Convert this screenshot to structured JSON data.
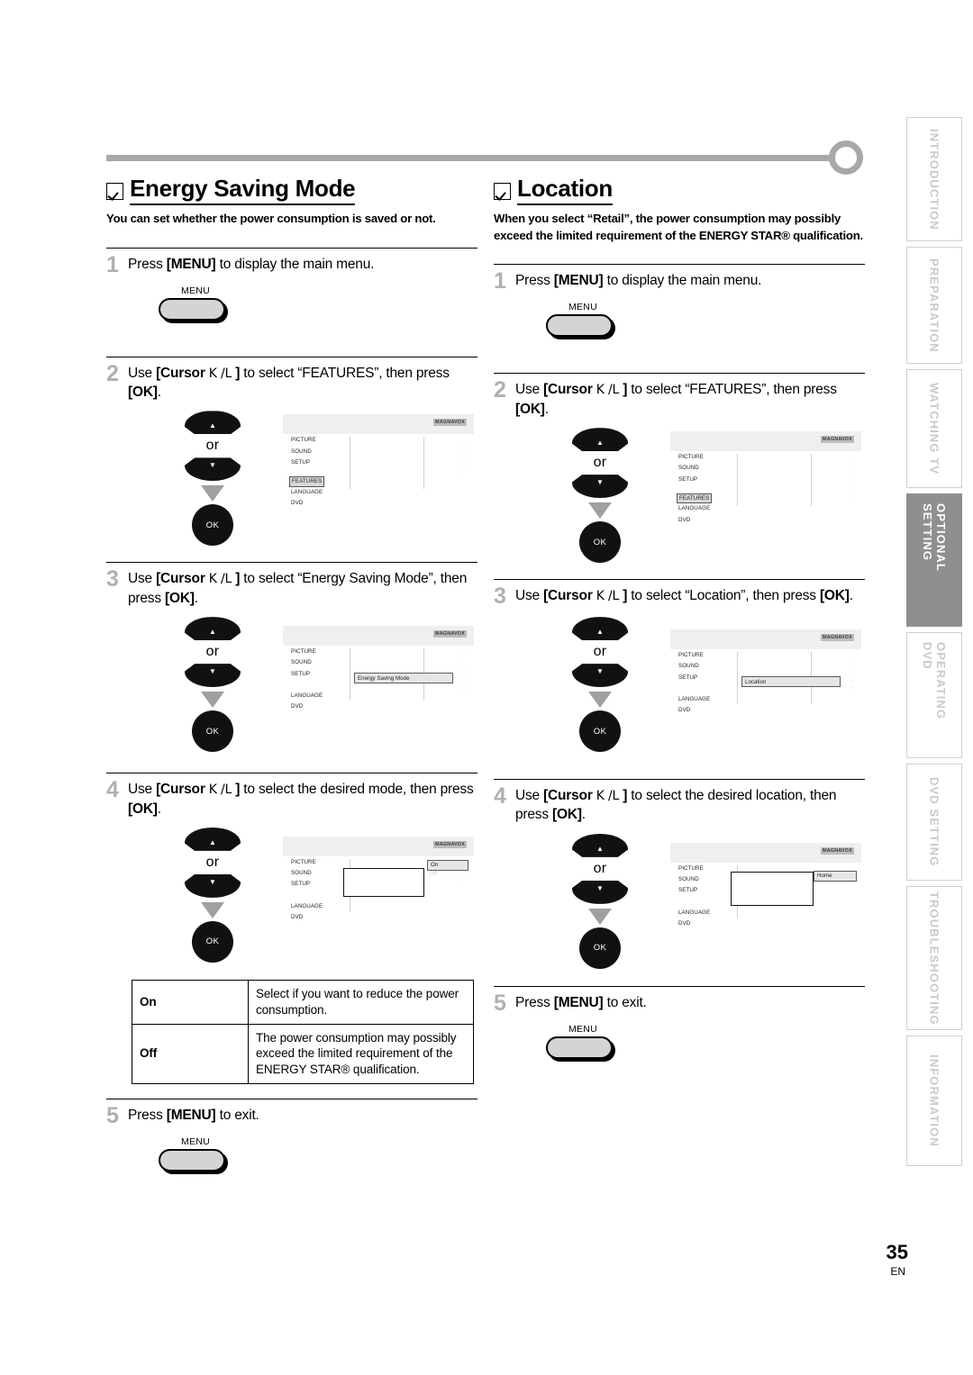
{
  "page": {
    "number": "35",
    "language_code": "EN"
  },
  "sidebar": {
    "tabs": [
      {
        "label": "INTRODUCTION",
        "active": false
      },
      {
        "label": "PREPARATION",
        "active": false
      },
      {
        "label": "WATCHING TV",
        "active": false
      },
      {
        "label": "OPTIONAL SETTING",
        "active": true
      },
      {
        "label": "OPERATING DVD",
        "active": false
      },
      {
        "label": "DVD SETTING",
        "active": false
      },
      {
        "label": "TROUBLESHOOTING",
        "active": false
      },
      {
        "label": "INFORMATION",
        "active": false
      }
    ]
  },
  "left_section": {
    "title": "Energy Saving Mode",
    "description": "You can set whether the power consumption is saved or not.",
    "steps": [
      {
        "number": "1",
        "text_before": "Press ",
        "bold_1": "[MENU]",
        "text_after": " to display the main menu.",
        "key_caption": "MENU"
      },
      {
        "number": "2",
        "text_before": "Use ",
        "bold_1": "[Cursor",
        "cursor_glyph": "K /L",
        "bold_2": "]",
        "text_mid": " to select “FEATURES”, then press ",
        "bold_3": "[OK]",
        "text_after": ".",
        "or_label": "or",
        "ok_label": "OK"
      },
      {
        "number": "3",
        "text_before": "Use ",
        "bold_1": "[Cursor",
        "cursor_glyph": "K /L",
        "bold_2": "]",
        "text_mid": " to select “Energy Saving Mode”, then press ",
        "bold_3": "[OK]",
        "text_after": ".",
        "or_label": "or",
        "ok_label": "OK"
      },
      {
        "number": "4",
        "text_before": "Use ",
        "bold_1": "[Cursor",
        "cursor_glyph": "K /L",
        "bold_2": "]",
        "text_mid": " to select the desired mode, then press ",
        "bold_3": "[OK]",
        "text_after": ".",
        "or_label": "or",
        "ok_label": "OK"
      },
      {
        "number": "5",
        "text_before": "Press ",
        "bold_1": "[MENU]",
        "text_after": " to exit.",
        "key_caption": "MENU"
      }
    ],
    "options_table": {
      "rows": [
        {
          "key": "On",
          "desc": "Select if you want to reduce the power consumption."
        },
        {
          "key": "Off",
          "desc": "The power consumption may possibly exceed the limited requirement of the ENERGY STAR® qualification."
        }
      ]
    }
  },
  "right_section": {
    "title": "Location",
    "description": "When you select “Retail”, the power consumption may possibly exceed the limited requirement of the ENERGY STAR® qualification.",
    "steps": [
      {
        "number": "1",
        "text_before": "Press ",
        "bold_1": "[MENU]",
        "text_after": " to display the main menu.",
        "key_caption": "MENU"
      },
      {
        "number": "2",
        "text_before": "Use ",
        "bold_1": "[Cursor",
        "cursor_glyph": "K /L",
        "bold_2": "]",
        "text_mid": " to select “FEATURES”, then press ",
        "bold_3": "[OK]",
        "text_after": ".",
        "or_label": "or",
        "ok_label": "OK"
      },
      {
        "number": "3",
        "text_before": "Use ",
        "bold_1": "[Cursor",
        "cursor_glyph": "K /L",
        "bold_2": "]",
        "text_mid": " to select “Location”, then press ",
        "bold_3": "[OK]",
        "text_after": ".",
        "or_label": "or",
        "ok_label": "OK"
      },
      {
        "number": "4",
        "text_before": "Use ",
        "bold_1": "[Cursor",
        "cursor_glyph": "K /L",
        "bold_2": "]",
        "text_mid": " to select the desired location, then press ",
        "bold_3": "[OK]",
        "text_after": ".",
        "or_label": "or",
        "ok_label": "OK"
      },
      {
        "number": "5",
        "text_before": "Press ",
        "bold_1": "[MENU]",
        "text_after": " to exit.",
        "key_caption": "MENU"
      }
    ]
  },
  "osd": {
    "brand": "MAGNAVOX",
    "menu_items": [
      "PICTURE",
      "SOUND",
      "SETUP",
      "FEATURES",
      "LANGUAGE",
      "DVD"
    ],
    "screens": {
      "features_selected": {
        "highlight": "FEATURES"
      },
      "energy_saving_mode": {
        "field_label": "Energy Saving Mode"
      },
      "energy_saving_value": {
        "selected_value": "On",
        "other_value": "Off"
      },
      "location_field": {
        "field_label": "Location"
      },
      "location_value": {
        "selected_value": "Home"
      }
    }
  }
}
